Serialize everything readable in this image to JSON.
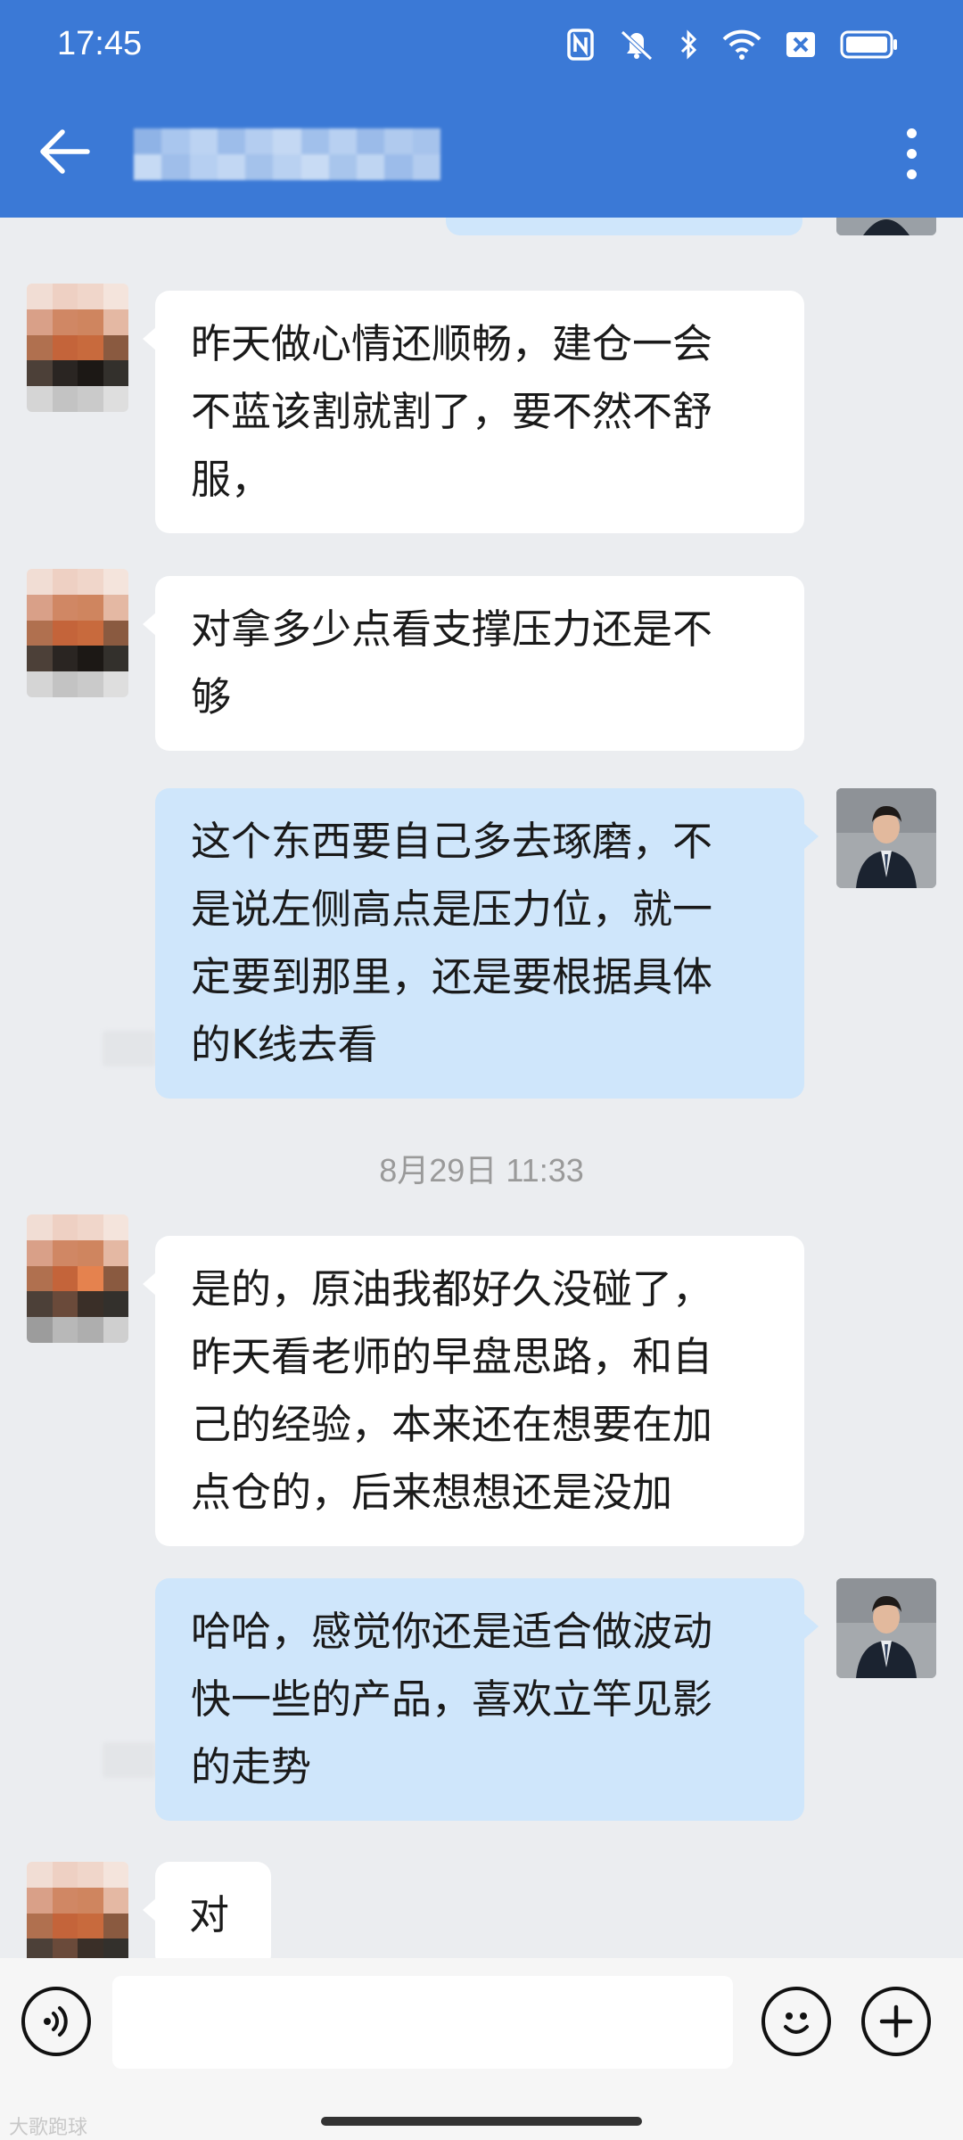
{
  "status_bar": {
    "time": "17:45",
    "icons": [
      "nfc-icon",
      "mute-vibrate-icon",
      "bluetooth-icon",
      "wifi-icon",
      "sim-off-icon",
      "battery-icon"
    ]
  },
  "header": {
    "title": "",
    "back_icon": "back-arrow-icon",
    "menu_icon": "more-vertical-icon",
    "bar_color": "#3b79d6"
  },
  "messages": [
    {
      "side": "in",
      "text": "昨天做心情还顺畅，建仓一会\n不蓝该割就割了，要不然不舒\n服，"
    },
    {
      "side": "in",
      "text": "对拿多少点看支撑压力还是不\n够"
    },
    {
      "side": "out",
      "text": "这个东西要自己多去琢磨，不\n是说左侧高点是压力位，就一\n定要到那里，还是要根据具体\n的K线去看"
    },
    {
      "side": "in",
      "text": "是的，原油我都好久没碰了，\n昨天看老师的早盘思路，和自\n己的经验，本来还在想要在加\n点仓的，后来想想还是没加"
    },
    {
      "side": "out",
      "text": "哈哈，感觉你还是适合做波动\n快一些的产品，喜欢立竿见影\n的走势"
    },
    {
      "side": "in",
      "text": "对"
    }
  ],
  "timestamp": "8月29日  11:33",
  "input_bar": {
    "placeholder": "",
    "voice_icon": "voice-icon",
    "emoji_icon": "emoji-icon",
    "plus_icon": "plus-icon"
  },
  "watermark": "大歌跑球",
  "colors": {
    "incoming_bubble": "#ffffff",
    "outgoing_bubble": "#cfe6fb",
    "chat_background": "#ebedf0"
  }
}
